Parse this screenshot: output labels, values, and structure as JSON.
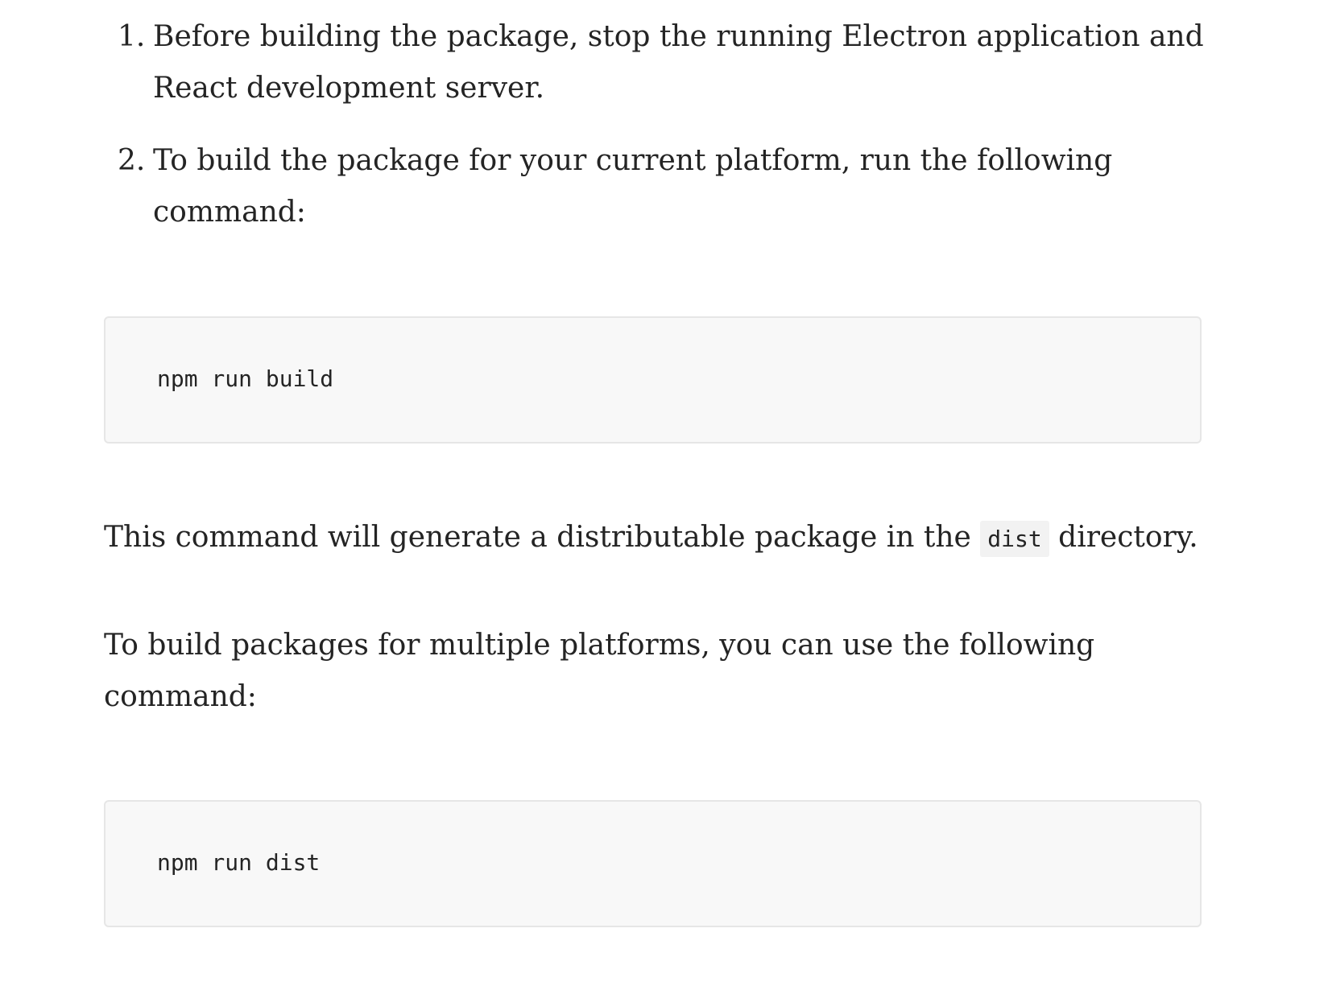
{
  "steps": [
    {
      "number": "1.",
      "text": "Before building the package, stop the running Electron application and React development server."
    },
    {
      "number": "2.",
      "text": "To build the package for your current platform, run the following command:"
    }
  ],
  "code_blocks": [
    {
      "code": "npm run build"
    },
    {
      "code": "npm run dist"
    }
  ],
  "paragraphs": {
    "dist_note": {
      "before": "This command will generate a distributable package in the ",
      "code": "dist",
      "after": " directory."
    },
    "multi_platform": "To build packages for multiple platforms, you can use the following command:"
  }
}
